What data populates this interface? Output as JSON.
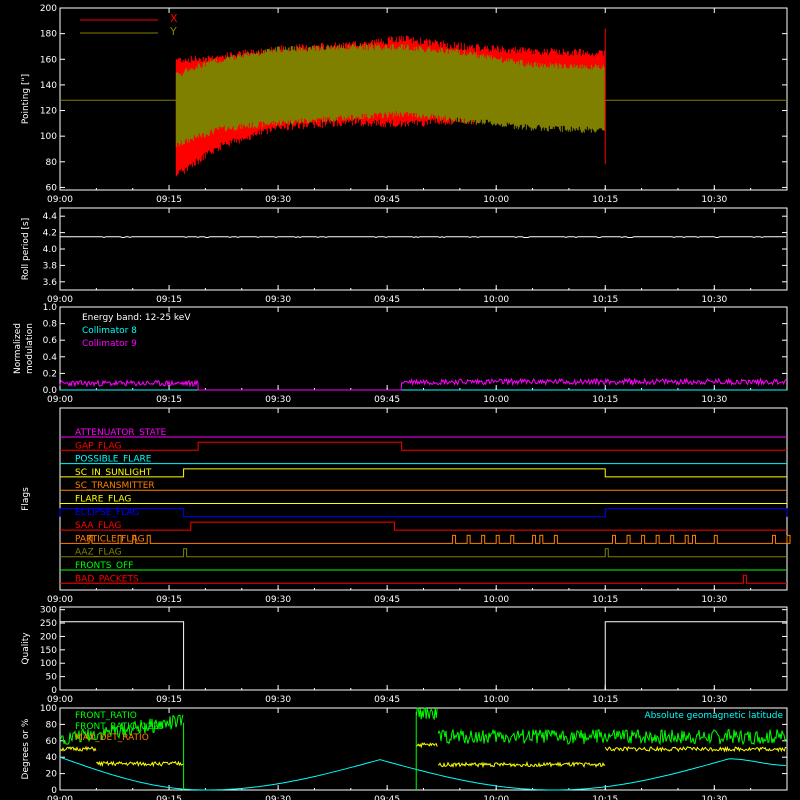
{
  "colors": {
    "background": "#000000",
    "foreground": "#ffffff",
    "x_red": "#ff0000",
    "y_olive": "#808000",
    "cyan": "#00ffff",
    "magenta": "#ff00ff",
    "green": "#00ff00",
    "yellow": "#ffff00",
    "orange": "#ff8000",
    "blue": "#0000ff",
    "red": "#ff0000",
    "purple": "#ff00ff"
  },
  "time_axis": {
    "range": [
      "09:00",
      "10:40"
    ],
    "ticks": [
      "09:00",
      "09:15",
      "09:30",
      "09:45",
      "10:00",
      "10:15",
      "10:30"
    ]
  },
  "chart_data": [
    {
      "id": "pointing",
      "type": "line",
      "ylabel": "Pointing [\"]",
      "ylim": [
        58,
        200
      ],
      "yticks": [
        60,
        80,
        100,
        120,
        140,
        160,
        180,
        200
      ],
      "legend": [
        "X",
        "Y"
      ],
      "legend_placement": "top-left",
      "series": [
        {
          "name": "X",
          "x": [
            "09:16",
            "09:18",
            "09:22",
            "09:30",
            "09:40",
            "09:47",
            "09:55",
            "10:05",
            "10:15"
          ],
          "upper": [
            160,
            160,
            162,
            168,
            171,
            176,
            170,
            166,
            165
          ],
          "lower": [
            72,
            80,
            95,
            110,
            114,
            112,
            115,
            116,
            117
          ]
        },
        {
          "name": "Y",
          "x": [
            "09:16",
            "09:18",
            "09:22",
            "09:30",
            "09:40",
            "09:47",
            "09:55",
            "10:05",
            "10:15"
          ],
          "upper": [
            150,
            155,
            162,
            170,
            172,
            172,
            168,
            158,
            156
          ],
          "lower": [
            90,
            95,
            103,
            108,
            112,
            115,
            110,
            104,
            102
          ]
        },
        {
          "name": "baseline",
          "x": [
            "09:00",
            "10:40"
          ],
          "values": [
            128,
            128
          ]
        }
      ]
    },
    {
      "id": "roll",
      "type": "line",
      "ylabel": "Roll period [s]",
      "ylim": [
        3.5,
        4.5
      ],
      "yticks": [
        "3.6",
        "3.8",
        "4.0",
        "4.2",
        "4.4"
      ],
      "series": [
        {
          "x": [
            "09:00",
            "10:40"
          ],
          "values": [
            4.15,
            4.15
          ]
        }
      ]
    },
    {
      "id": "modulation",
      "type": "line",
      "ylabel": "Normalized modulation",
      "ylim": [
        0,
        1
      ],
      "yticks": [
        "0.0",
        "0.2",
        "0.4",
        "0.6",
        "0.8",
        "1.0"
      ],
      "annotations": [
        "Energy band: 12-25 keV",
        "Collimator 8",
        "Collimator 9"
      ],
      "series": [
        {
          "name": "Collimator 8",
          "x": [
            "09:00",
            "10:40"
          ],
          "values": [
            0,
            0
          ]
        },
        {
          "name": "Collimator 9",
          "segments": [
            [
              "09:00",
              "09:19",
              0.08
            ],
            [
              "09:19",
              "09:47",
              0.0
            ],
            [
              "09:47",
              "10:40",
              0.1
            ]
          ]
        }
      ]
    },
    {
      "id": "flags",
      "type": "line",
      "ylabel": "Flags",
      "series": [
        {
          "name": "ATTENUATOR_STATE",
          "steps": []
        },
        {
          "name": "GAP_FLAG",
          "steps": [
            [
              "09:19",
              "09:47"
            ]
          ]
        },
        {
          "name": "POSSIBLE_FLARE",
          "steps": []
        },
        {
          "name": "SC_IN_SUNLIGHT",
          "steps": [
            [
              "09:17",
              "10:15"
            ]
          ]
        },
        {
          "name": "SC_TRANSMITTER",
          "steps": []
        },
        {
          "name": "FLARE_FLAG",
          "steps": []
        },
        {
          "name": "ECLIPSE_FLAG",
          "steps": [
            [
              "09:00",
              "09:17"
            ],
            [
              "10:15",
              "10:40"
            ]
          ]
        },
        {
          "name": "SAA_FLAG",
          "steps": [
            [
              "09:18",
              "09:46"
            ]
          ]
        },
        {
          "name": "PARTICLE_FLAG",
          "spikes": [
            "09:04",
            "09:08",
            "09:10",
            "09:12",
            "09:54",
            "09:56",
            "09:58",
            "10:00",
            "10:02",
            "10:05",
            "10:06",
            "10:08",
            "10:16",
            "10:18",
            "10:20",
            "10:22",
            "10:24",
            "10:26",
            "10:27",
            "10:30",
            "10:38",
            "10:40"
          ]
        },
        {
          "name": "AAZ_FLAG",
          "spikes": [
            "09:17",
            "10:15"
          ]
        },
        {
          "name": "FRONTS_OFF",
          "steps": []
        },
        {
          "name": "BAD_PACKETS",
          "spikes": [
            "10:34"
          ]
        }
      ]
    },
    {
      "id": "quality",
      "type": "line",
      "ylabel": "Quality",
      "ylim": [
        0,
        310
      ],
      "yticks": [
        "0",
        "50",
        "100",
        "150",
        "200",
        "250",
        "300"
      ],
      "series": [
        {
          "segments": [
            [
              "09:00",
              "09:17",
              255
            ],
            [
              "09:17",
              "10:15",
              0
            ],
            [
              "10:15",
              "10:40",
              255
            ]
          ]
        }
      ]
    },
    {
      "id": "ratios",
      "type": "line",
      "ylabel": "Degrees or %",
      "ylim": [
        0,
        100
      ],
      "yticks": [
        "0",
        "20",
        "40",
        "60",
        "80",
        "100"
      ],
      "legend": [
        "FRONT_RATIO",
        "FRONT_RATIO_1225",
        "MAX_DET_RATIO"
      ],
      "annotation_right": "Absolute geomagnetic latitude",
      "series": [
        {
          "name": "FRONT_RATIO",
          "segments": [
            [
              "09:00",
              "09:17",
              82
            ],
            [
              "09:49",
              "09:52",
              95
            ],
            [
              "09:52",
              "10:40",
              65
            ]
          ]
        },
        {
          "name": "MAX_DET_RATIO",
          "segments": [
            [
              "09:00",
              "09:05",
              50
            ],
            [
              "09:05",
              "09:17",
              32
            ],
            [
              "09:49",
              "09:52",
              55
            ],
            [
              "09:52",
              "10:15",
              31
            ],
            [
              "10:15",
              "10:40",
              50
            ]
          ]
        },
        {
          "name": "Absolute geomagnetic latitude",
          "x": [
            "09:00",
            "09:20",
            "09:44",
            "10:08",
            "10:32",
            "10:40"
          ],
          "values": [
            40,
            0,
            37,
            0,
            38,
            30
          ]
        }
      ]
    }
  ]
}
